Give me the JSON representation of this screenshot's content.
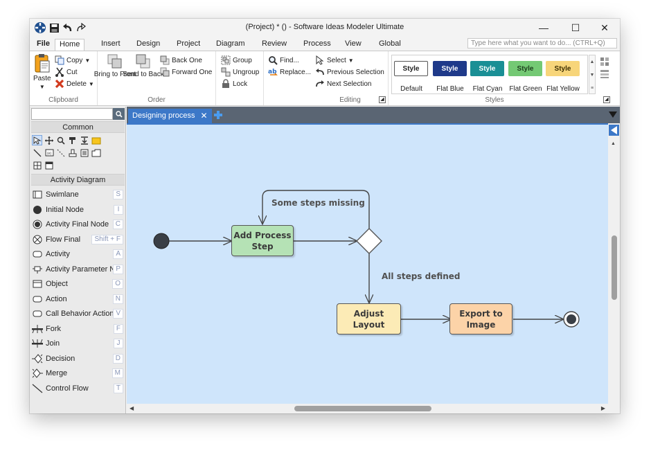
{
  "window": {
    "title": "(Project) * () - Software Ideas Modeler Ultimate",
    "minimize": "—",
    "maximize": "☐",
    "close": "✕"
  },
  "ribbon_tabs": [
    "File",
    "Home",
    "Insert",
    "Design",
    "Project",
    "Diagram",
    "Review",
    "Process",
    "View",
    "Global"
  ],
  "active_tab": "Home",
  "search": {
    "placeholder": "Type here what you want to do...  (CTRL+Q)"
  },
  "ribbon": {
    "clipboard": {
      "label": "Clipboard",
      "paste": "Paste",
      "copy": "Copy",
      "cut": "Cut",
      "delete": "Delete"
    },
    "order": {
      "label": "Order",
      "bring_to_front": "Bring to Front",
      "send_to_back": "Send to Back",
      "back_one": "Back One",
      "forward_one": "Forward One"
    },
    "group": {
      "group": "Group",
      "ungroup": "Ungroup",
      "lock": "Lock"
    },
    "find": {
      "find": "Find...",
      "replace": "Replace..."
    },
    "editing": {
      "label": "Editing",
      "select": "Select",
      "previous_selection": "Previous Selection",
      "next_selection": "Next Selection"
    },
    "styles": {
      "label": "Styles",
      "items": [
        {
          "swatch": "Style",
          "name": "Default",
          "bg": "#ffffff",
          "fg": "#222222",
          "border": "#555555"
        },
        {
          "swatch": "Style",
          "name": "Flat Blue",
          "bg": "#1f3a8a",
          "fg": "#ffffff",
          "border": "#1f3a8a"
        },
        {
          "swatch": "Style",
          "name": "Flat Cyan",
          "bg": "#1a8f95",
          "fg": "#ffffff",
          "border": "#1a8f95"
        },
        {
          "swatch": "Style",
          "name": "Flat Green",
          "bg": "#74c974",
          "fg": "#1d3d1d",
          "border": "#74c974"
        },
        {
          "swatch": "Style",
          "name": "Flat Yellow",
          "bg": "#f7d57a",
          "fg": "#3a2d00",
          "border": "#f7d57a"
        }
      ]
    }
  },
  "toolbox": {
    "common_header": "Common",
    "activity_header": "Activity Diagram",
    "items": [
      {
        "label": "Swimlane",
        "key": "S",
        "icon": "swimlane-icon"
      },
      {
        "label": "Initial Node",
        "key": "I",
        "icon": "initial-node-icon"
      },
      {
        "label": "Activity Final Node",
        "key": "C",
        "icon": "activity-final-node-icon"
      },
      {
        "label": "Flow Final",
        "key": "Shift + F",
        "icon": "flow-final-icon"
      },
      {
        "label": "Activity",
        "key": "A",
        "icon": "activity-icon"
      },
      {
        "label": "Activity Parameter Node",
        "key": "P",
        "icon": "activity-parameter-icon"
      },
      {
        "label": "Object",
        "key": "O",
        "icon": "object-icon"
      },
      {
        "label": "Action",
        "key": "N",
        "icon": "action-icon"
      },
      {
        "label": "Call Behavior Action",
        "key": "V",
        "icon": "call-behavior-icon"
      },
      {
        "label": "Fork",
        "key": "F",
        "icon": "fork-icon"
      },
      {
        "label": "Join",
        "key": "J",
        "icon": "join-icon"
      },
      {
        "label": "Decision",
        "key": "D",
        "icon": "decision-icon"
      },
      {
        "label": "Merge",
        "key": "M",
        "icon": "merge-icon"
      },
      {
        "label": "Control Flow",
        "key": "T",
        "icon": "control-flow-icon"
      }
    ]
  },
  "document_tab": {
    "label": "Designing process"
  },
  "diagram": {
    "nodes": {
      "add_process_step": "Add Process Step",
      "adjust_layout": "Adjust Layout",
      "export_to_image": "Export to Image"
    },
    "labels": {
      "some_steps_missing": "Some steps missing",
      "all_steps_defined": "All steps defined"
    },
    "colors": {
      "canvas": "#cfe5fb",
      "green_node": "#b5e2b5",
      "yellow_node": "#fcebb6",
      "orange_node": "#fcd3a8"
    }
  }
}
